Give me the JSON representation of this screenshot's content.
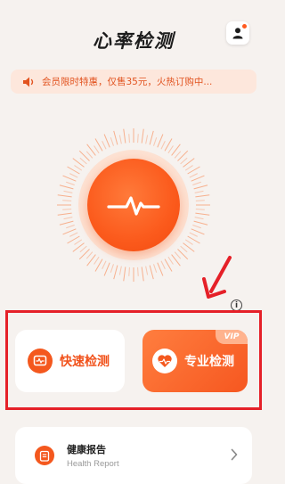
{
  "header": {
    "title": "心率检测"
  },
  "promo": {
    "text": "会员限时特惠，仅售35元，火热订购中..."
  },
  "actions": {
    "quick": {
      "label": "快速检测"
    },
    "pro": {
      "label": "专业检测",
      "badge": "VIP"
    }
  },
  "info": {
    "glyph": "i"
  },
  "report": {
    "title": "健康报告",
    "subtitle": "Health Report"
  },
  "colors": {
    "accent": "#f4581e",
    "highlight": "#e52028",
    "promo_bg": "#fde7dc",
    "background": "#f6f2ef"
  },
  "icons": [
    "user-icon",
    "speaker-icon",
    "pulse-icon",
    "monitor-heart-icon",
    "heart-pulse-icon",
    "info-icon",
    "report-icon",
    "chevron-right-icon",
    "arrow-icon"
  ]
}
